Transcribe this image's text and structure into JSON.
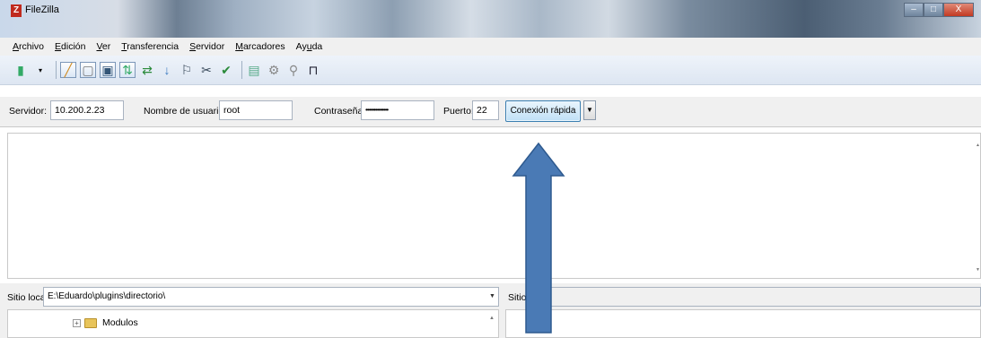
{
  "window": {
    "title": "FileZilla",
    "minimize": "–",
    "maximize": "□",
    "close": "X"
  },
  "menu": {
    "items": [
      {
        "first": "A",
        "rest": "rchivo"
      },
      {
        "first": "E",
        "rest": "dición"
      },
      {
        "first": "V",
        "rest": "er"
      },
      {
        "first": "T",
        "rest": "ransferencia"
      },
      {
        "first": "S",
        "rest": "ervidor"
      },
      {
        "first": "M",
        "rest": "arcadores"
      },
      {
        "pre": "Ay",
        "first": "u",
        "rest": "da"
      }
    ]
  },
  "toolbar": {
    "icons": [
      "site-manager-icon",
      "dropdown-icon",
      "message-log-icon",
      "local-tree-icon",
      "remote-tree-icon",
      "queue-icon",
      "refresh-icon",
      "process-queue-icon",
      "cancel-icon",
      "disconnect-icon",
      "reconnect-icon",
      "filter-icon",
      "compare-icon",
      "sync-browse-icon",
      "search-icon"
    ]
  },
  "quickconnect": {
    "server_label": "Servidor:",
    "server_value": "10.200.2.23",
    "username_label": "Nombre de usuario:",
    "username_value": "root",
    "password_label": "Contraseña:",
    "password_value": "••••••••••••••",
    "port_label": "Puerto:",
    "port_value": "22",
    "connect_button": "Conexión rápida",
    "dropdown_glyph": "▼"
  },
  "local": {
    "label": "Sitio local:",
    "path": "E:\\Eduardo\\plugins\\directorio\\",
    "tree": [
      {
        "name": "Modulos",
        "expander": "+"
      }
    ]
  },
  "remote": {
    "label": "Sitio remoto:",
    "path": ""
  },
  "annotation": {
    "color": "#4a7ab5"
  }
}
